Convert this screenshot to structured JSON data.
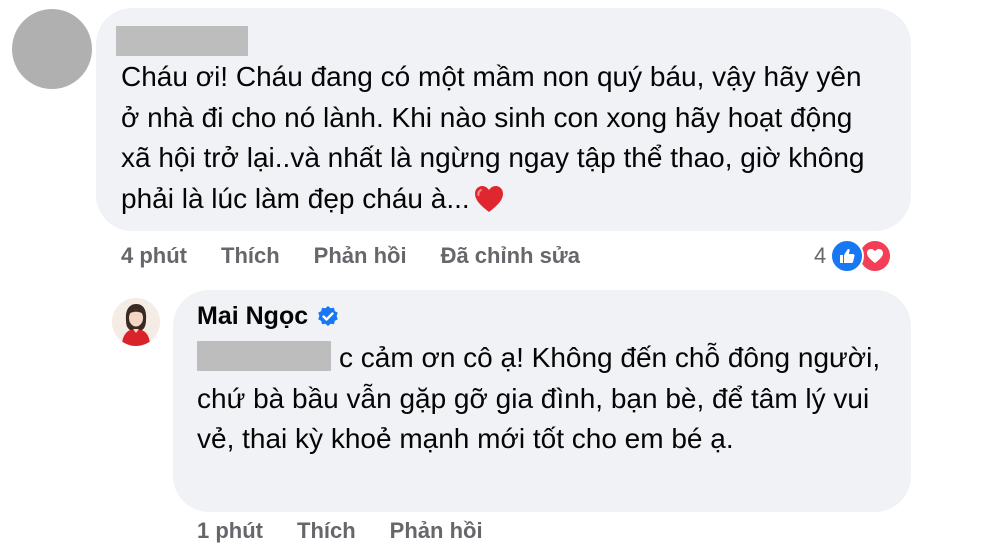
{
  "comment": {
    "text": "Cháu ơi! Cháu đang có một mầm non quý báu, vậy hãy yên ở nhà đi cho nó lành. Khi nào sinh con xong hãy hoạt động xã hội trở lại..và nhất là ngừng ngay tập thể thao, giờ không phải là lúc làm đẹp cháu à...",
    "emoji": "heart-icon",
    "time": "4 phút",
    "like_label": "Thích",
    "reply_label": "Phản hồi",
    "edited_label": "Đã chỉnh sửa",
    "reaction_count": "4",
    "reactions": [
      "like-icon",
      "love-icon"
    ]
  },
  "reply": {
    "author": "Mai Ngọc",
    "verified": "verified-badge-icon",
    "text": "c cảm ơn cô ạ! Không đến chỗ đông người, chứ bà bầu vẫn gặp gỡ gia đình, bạn bè, để tâm lý vui vẻ, thai kỳ khoẻ mạnh mới tốt cho em bé ạ.",
    "time": "1 phút",
    "like_label": "Thích",
    "reply_label": "Phản hồi"
  },
  "colors": {
    "bubble": "#f0f2f5",
    "meta_text": "#65676b",
    "like_blue": "#1877f2",
    "love_red": "#f33e58",
    "redaction": "#bdbdbd"
  }
}
